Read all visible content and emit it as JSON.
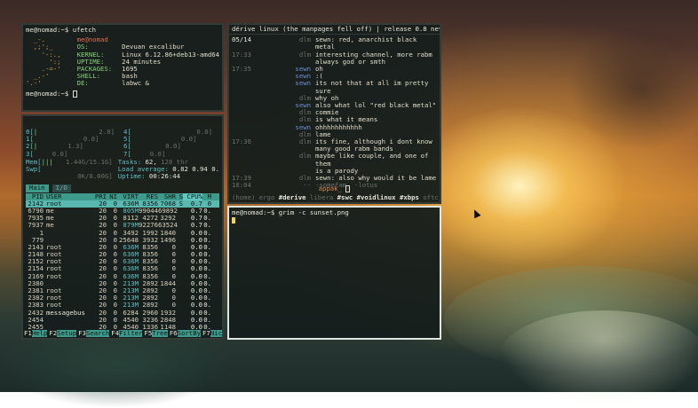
{
  "ufetch": {
    "prompt": "me@nomad:~$ ufetch",
    "logo": [
      "  _-.",
      "  ,;';_",
      "    '-:.,",
      "      ':;",
      "    .-=-'",
      "  _.-'",
      "'.-'"
    ],
    "keys": [
      "me@nomad",
      "OS:",
      "KERNEL:",
      "UPTIME:",
      "PACKAGES:",
      "SHELL:",
      "DE:"
    ],
    "values": [
      "",
      "Devuan excalibur",
      "Linux 6.12.86+deb13-amd64",
      "24 minutes",
      "1695",
      "bash",
      "labwc &"
    ],
    "end_prompt": "me@nomad:~$"
  },
  "htop": {
    "cpus": [
      {
        "id": "0[",
        "bar": "|",
        "pct": "2.0]"
      },
      {
        "id": "1[",
        "bar": "",
        "pct": "0.0]"
      },
      {
        "id": "2[",
        "bar": "|",
        "pct": "1.3]"
      },
      {
        "id": "3[",
        "bar": "",
        "pct": "0.0]"
      }
    ],
    "cpus_right": [
      {
        "id": "4[",
        "pct": "0.0]"
      },
      {
        "id": "5[",
        "pct": "0.0]"
      },
      {
        "id": "6[",
        "pct": "0.0]"
      },
      {
        "id": "7[",
        "pct": "0.0]"
      }
    ],
    "mem_label": "Mem[",
    "mem_val": "1.44G/15.1G]",
    "swp_label": "Swp[",
    "swp_val": "0K/8.00G]",
    "tasks": "Tasks: ",
    "tasks_n": "62,",
    "tasks_thr": " 128 thr",
    "load": "Load average: ",
    "load_vals": "0.82 0.94 0.",
    "uptime_label": "Uptime: ",
    "uptime_val": "00:26:44",
    "tabs": [
      "Main",
      "I/O"
    ],
    "columns": {
      "pid": "PID",
      "user": "USER",
      "pri": "PRI",
      "ni": "NI",
      "virt": "VIRT",
      "res": "RES",
      "shr": "SHR",
      "s": "S",
      "cpu": "CPU%",
      "mem": "M"
    },
    "rows": [
      {
        "pid": "2142",
        "user": "root",
        "pri": "20",
        "ni": "0",
        "virt": "636M",
        "res": "8356",
        "shr": "7068",
        "s": "S",
        "cpu": "0.7",
        "mem": "0"
      },
      {
        "pid": "6790",
        "user": "me",
        "pri": "20",
        "ni": "0",
        "virt": "805M",
        "res": "99044",
        "shr": "69892",
        "s": "",
        "cpu": "0.7",
        "mem": "0."
      },
      {
        "pid": "7935",
        "user": "me",
        "pri": "20",
        "ni": "0",
        "virt": "8112",
        "res": "4272",
        "shr": "3292",
        "s": "",
        "cpu": "0.7",
        "mem": "0."
      },
      {
        "pid": "7937",
        "user": "me",
        "pri": "20",
        "ni": "0",
        "virt": "879M",
        "res": "92276",
        "shr": "63524",
        "s": "",
        "cpu": "0.7",
        "mem": "0."
      },
      {
        "pid": "1",
        "user": "",
        "pri": "20",
        "ni": "0",
        "virt": "3492",
        "res": "1992",
        "shr": "1840",
        "s": "",
        "cpu": "0.0",
        "mem": "0."
      },
      {
        "pid": "779",
        "user": "",
        "pri": "20",
        "ni": "0",
        "virt": "25648",
        "res": "3932",
        "shr": "1496",
        "s": "",
        "cpu": "0.0",
        "mem": "0."
      },
      {
        "pid": "2143",
        "user": "root",
        "pri": "20",
        "ni": "0",
        "virt": "636M",
        "res": "8356",
        "shr": "0",
        "s": "",
        "cpu": "0.0",
        "mem": "0."
      },
      {
        "pid": "2148",
        "user": "root",
        "pri": "20",
        "ni": "0",
        "virt": "636M",
        "res": "8356",
        "shr": "0",
        "s": "",
        "cpu": "0.0",
        "mem": "0."
      },
      {
        "pid": "2152",
        "user": "root",
        "pri": "20",
        "ni": "0",
        "virt": "636M",
        "res": "8356",
        "shr": "0",
        "s": "",
        "cpu": "0.0",
        "mem": "0."
      },
      {
        "pid": "2154",
        "user": "root",
        "pri": "20",
        "ni": "0",
        "virt": "636M",
        "res": "8356",
        "shr": "0",
        "s": "",
        "cpu": "0.0",
        "mem": "0."
      },
      {
        "pid": "2169",
        "user": "root",
        "pri": "20",
        "ni": "0",
        "virt": "636M",
        "res": "8356",
        "shr": "0",
        "s": "",
        "cpu": "0.0",
        "mem": "0."
      },
      {
        "pid": "2380",
        "user": "",
        "pri": "20",
        "ni": "0",
        "virt": "213M",
        "res": "2892",
        "shr": "1844",
        "s": "",
        "cpu": "0.0",
        "mem": "0."
      },
      {
        "pid": "2381",
        "user": "root",
        "pri": "20",
        "ni": "0",
        "virt": "213M",
        "res": "2892",
        "shr": "0",
        "s": "",
        "cpu": "0.0",
        "mem": "0."
      },
      {
        "pid": "2382",
        "user": "root",
        "pri": "20",
        "ni": "0",
        "virt": "213M",
        "res": "2892",
        "shr": "0",
        "s": "",
        "cpu": "0.0",
        "mem": "0."
      },
      {
        "pid": "2383",
        "user": "root",
        "pri": "20",
        "ni": "0",
        "virt": "213M",
        "res": "2892",
        "shr": "0",
        "s": "",
        "cpu": "0.0",
        "mem": "0."
      },
      {
        "pid": "2432",
        "user": "messagebus",
        "pri": "20",
        "ni": "0",
        "virt": "6284",
        "res": "2960",
        "shr": "1932",
        "s": "",
        "cpu": "0.0",
        "mem": "0."
      },
      {
        "pid": "2454",
        "user": "",
        "pri": "20",
        "ni": "0",
        "virt": "4540",
        "res": "3236",
        "shr": "2848",
        "s": "",
        "cpu": "0.0",
        "mem": "0."
      },
      {
        "pid": "2455",
        "user": "",
        "pri": "20",
        "ni": "0",
        "virt": "4540",
        "res": "1336",
        "shr": "1148",
        "s": "",
        "cpu": "0.0",
        "mem": "0."
      }
    ],
    "fkeys": [
      {
        "k": "F1",
        "l": "Help"
      },
      {
        "k": "F2",
        "l": "Setup"
      },
      {
        "k": "F3",
        "l": "Search"
      },
      {
        "k": "F4",
        "l": "Filter"
      },
      {
        "k": "F5",
        "l": "Tree"
      },
      {
        "k": "F6",
        "l": "SortBy"
      },
      {
        "k": "F7",
        "l": "Nice"
      }
    ]
  },
  "irc": {
    "topic": "dérive linux (the manpages fell off) | release 0.8 never",
    "messages": [
      {
        "time": "05/14",
        "nick": "dlm",
        "text": "sewn: red, anarchist black metal",
        "nickClass": "dim"
      },
      {
        "time": "17:33",
        "nick": "dlm",
        "text": "interesting channel, more rabm",
        "nickClass": "dim"
      },
      {
        "time": "",
        "nick": "",
        "text": "always god or smth",
        "nickClass": "dim"
      },
      {
        "time": "17:35",
        "nick": "sewn",
        "text": "oh",
        "nickClass": "blue"
      },
      {
        "time": "",
        "nick": "sewn",
        "text": ":(",
        "nickClass": "blue"
      },
      {
        "time": "",
        "nick": "sewn",
        "text": "its not that at all im pretty sure",
        "nickClass": "blue"
      },
      {
        "time": "",
        "nick": "dlm",
        "text": "why oh",
        "nickClass": "dim"
      },
      {
        "time": "",
        "nick": "sewn",
        "text": "also what lol \"red black metal\"",
        "nickClass": "blue"
      },
      {
        "time": "",
        "nick": "dlm",
        "text": "commie",
        "nickClass": "dim"
      },
      {
        "time": "",
        "nick": "dlm",
        "text": "is what it means",
        "nickClass": "dim"
      },
      {
        "time": "",
        "nick": "sewn",
        "text": "ohhhhhhhhhhh",
        "nickClass": "blue"
      },
      {
        "time": "",
        "nick": "dlm",
        "text": "lame",
        "nickClass": "dim"
      },
      {
        "time": "17:36",
        "nick": "dlm",
        "text": "its fine, although i dont know",
        "nickClass": "dim"
      },
      {
        "time": "",
        "nick": "",
        "text": "many good rabm bands",
        "nickClass": "dim"
      },
      {
        "time": "",
        "nick": "dlm",
        "text": "maybe like couple, and one of them",
        "nickClass": "dim"
      },
      {
        "time": "",
        "nick": "",
        "text": "is a parody",
        "nickClass": "dim"
      },
      {
        "time": "17:39",
        "nick": "dlm",
        "text": "sewn: also why would it be lame",
        "nickClass": "dim"
      },
      {
        "time": "18:04",
        "nick": "--",
        "text": "-somefam_  -lotus",
        "nickClass": "dim"
      }
    ],
    "input_nick": "appak_",
    "status_parts": [
      {
        "t": "(home) ",
        "c": "dim"
      },
      {
        "t": "ergo ",
        "c": "dim"
      },
      {
        "t": "#derive ",
        "c": "white"
      },
      {
        "t": "libera ",
        "c": "dim"
      },
      {
        "t": "#swc ",
        "c": "white"
      },
      {
        "t": "#voidlinux ",
        "c": "white"
      },
      {
        "t": "#xbps ",
        "c": "white"
      },
      {
        "t": "oftc ",
        "c": "dim"
      },
      {
        "t": "#c..",
        "c": "white"
      }
    ]
  },
  "shell": {
    "prompt": "me@nomad:~$ grim -c sunset.png"
  }
}
